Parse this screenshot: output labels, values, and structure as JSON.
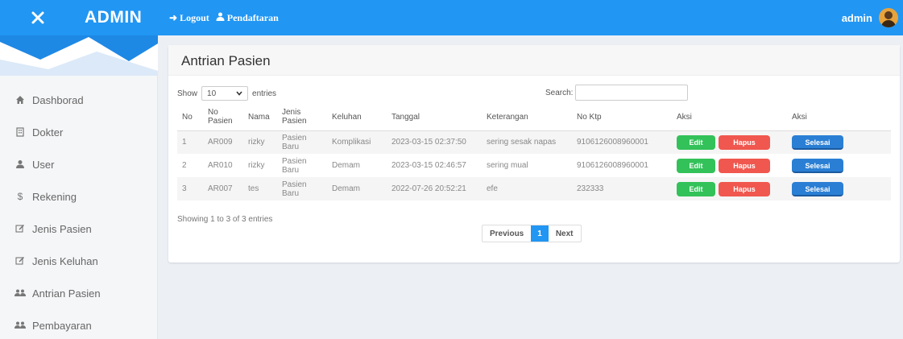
{
  "header": {
    "brand": "ADMIN",
    "nav": [
      {
        "label": "Logout"
      },
      {
        "label": "Pendaftaran"
      }
    ],
    "user": "admin"
  },
  "sidebar": {
    "items": [
      {
        "label": "Dashborad",
        "icon": "home-icon"
      },
      {
        "label": "Dokter",
        "icon": "building-icon"
      },
      {
        "label": "User",
        "icon": "user-icon"
      },
      {
        "label": "Rekening",
        "icon": "dollar-icon"
      },
      {
        "label": "Jenis Pasien",
        "icon": "edit-icon"
      },
      {
        "label": "Jenis Keluhan",
        "icon": "edit-icon"
      },
      {
        "label": "Antrian Pasien",
        "icon": "users-icon"
      },
      {
        "label": "Pembayaran",
        "icon": "users-icon"
      }
    ]
  },
  "main": {
    "title": "Antrian Pasien",
    "show_label": "Show",
    "entries_value": "10",
    "entries_label": "entries",
    "search_label": "Search:",
    "search_value": "",
    "columns": [
      "No",
      "No Pasien",
      "Nama",
      "Jenis Pasien",
      "Keluhan",
      "Tanggal",
      "Keterangan",
      "No Ktp",
      "Aksi",
      "Aksi"
    ],
    "rows": [
      {
        "no": "1",
        "no_pasien": "AR009",
        "nama": "rizky",
        "jenis": "Pasien Baru",
        "keluhan": "Komplikasi",
        "tanggal": "2023-03-15 02:37:50",
        "keterangan": "sering sesak napas",
        "ktp": "9106126008960001"
      },
      {
        "no": "2",
        "no_pasien": "AR010",
        "nama": "rizky",
        "jenis": "Pasien Baru",
        "keluhan": "Demam",
        "tanggal": "2023-03-15 02:46:57",
        "keterangan": "sering mual",
        "ktp": "9106126008960001"
      },
      {
        "no": "3",
        "no_pasien": "AR007",
        "nama": "tes",
        "jenis": "Pasien Baru",
        "keluhan": "Demam",
        "tanggal": "2022-07-26 20:52:21",
        "keterangan": "efe",
        "ktp": "232333"
      }
    ],
    "buttons": {
      "edit": "Edit",
      "hapus": "Hapus",
      "selesai": "Selesai"
    },
    "info": "Showing 1 to 3 of 3 entries",
    "pager": {
      "previous": "Previous",
      "current": "1",
      "next": "Next"
    }
  },
  "colors": {
    "primary": "#2196f3",
    "edit": "#33c159",
    "delete": "#f0574e",
    "done": "#2a7fd4"
  }
}
